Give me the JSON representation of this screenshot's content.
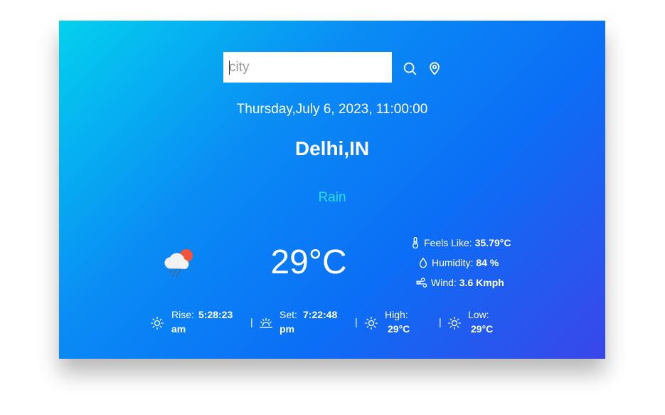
{
  "search": {
    "placeholder": "city",
    "value": ""
  },
  "icons": {
    "search": "search-icon",
    "location": "location-pin-icon",
    "weather": "rain-cloud-sun-icon"
  },
  "datetime": "Thursday,July 6, 2023, 11:00:00",
  "city": "Delhi,IN",
  "condition": "Rain",
  "temperature": "29°C",
  "details": {
    "feels_like": {
      "label": "Feels Like:",
      "value": "35.79°C"
    },
    "humidity": {
      "label": "Humidity:",
      "value": "84 %"
    },
    "wind": {
      "label": "Wind:",
      "value": "3.6 Kmph"
    }
  },
  "stats": {
    "rise": {
      "label": "Rise:",
      "value_line1": "5:28:23",
      "value_line2": "am"
    },
    "set": {
      "label": "Set:",
      "value_line1": "7:22:48",
      "value_line2": "pm"
    },
    "high": {
      "label": "High:",
      "value": "29°C"
    },
    "low": {
      "label": "Low:",
      "value": "29°C"
    },
    "separator": "|"
  },
  "colors": {
    "condition": "#22e3f2",
    "gradient_start": "#03d1ee",
    "gradient_end": "#3a46ea"
  }
}
